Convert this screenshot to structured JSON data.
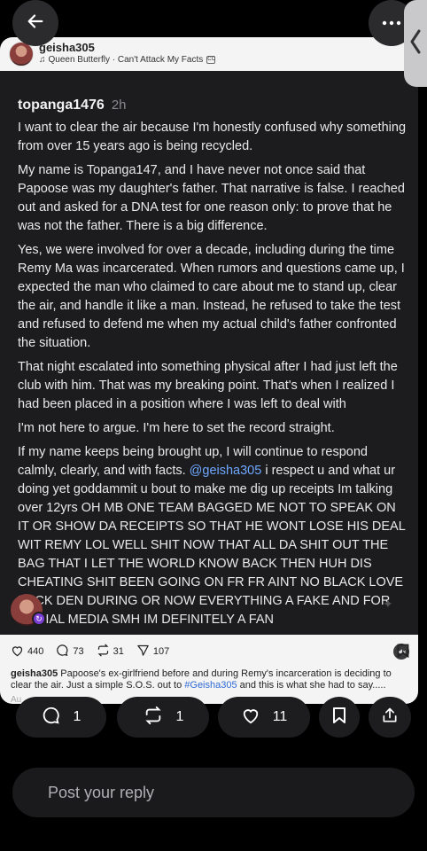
{
  "nav": {
    "back_icon": "arrow-left-icon",
    "more_icon": "more-horizontal-icon",
    "side_icon": "chevron-left-icon"
  },
  "card": {
    "username": "geisha305",
    "song": "Queen Butterfly · Can't Attack My Facts",
    "post": {
      "username": "topanga1476",
      "time": "2h",
      "paragraphs": [
        "I want to clear the air because I'm honestly confused why something from over 15 years ago is being recycled.",
        "My name is Topanga147, and I have never not once said that Papoose was my daughter's father. That narrative is false. I reached out and asked for a DNA test for one reason only: to prove that he was not the father. There is a big difference.",
        "Yes, we were involved for over a decade, including during the time Remy Ma was incarcerated. When rumors and questions came up, I expected the man who claimed to care about me to stand up, clear the air, and handle it like a man. Instead, he refused to take the test and refused to defend me when my actual child's father confronted the situation.",
        "That night escalated into something physical after I had just left the club with him. That was my breaking point. That's when I realized I had been placed in a position where I was left to deal with",
        "I'm not here to argue. I'm here to set the record straight."
      ],
      "last_para_before": "If my name keeps being brought up, I will continue to respond calmly, clearly, and with facts. ",
      "last_para_mention": "@geisha305",
      "last_para_after": " i respect u and what ur doing yet goddammit u bout to make me dig up receipts Im talking over 12yrs OH MB ONE TEAM BAGGED ME NOT TO SPEAK ON IT OR SHOW DA RECEIPTS SO THAT HE WONT LOSE HIS DEAL WIT REMY LOL WELL SHIT NOW THAT ALL DA SHIT OUT THE BAG THAT I LET THE WORLD KNOW BACK THEN HUH DIS CHEATING SHIT BEEN GOING ON FR FR AINT NO BLACK LOVE BACK DEN DURING OR NOW EVERYTHING A FAKE AND FOR SOCIAL MEDIA SMH IM DEFINITELY A FAN"
    },
    "stats": {
      "likes": "440",
      "comments": "73",
      "reposts": "31",
      "shares": "107"
    },
    "caption": {
      "user": "geisha305",
      "text_before": " Papoose's ex-girlfriend before and during Remy's incarceration is deciding to clear the air. Just a simple S.O.S. out to ",
      "hashtag": "#Geisha305",
      "text_after": " and this is what she had to say.....",
      "more": "Au"
    }
  },
  "actions": {
    "comments": "1",
    "reposts": "1",
    "likes": "11"
  },
  "reply": {
    "placeholder": "Post your reply"
  }
}
